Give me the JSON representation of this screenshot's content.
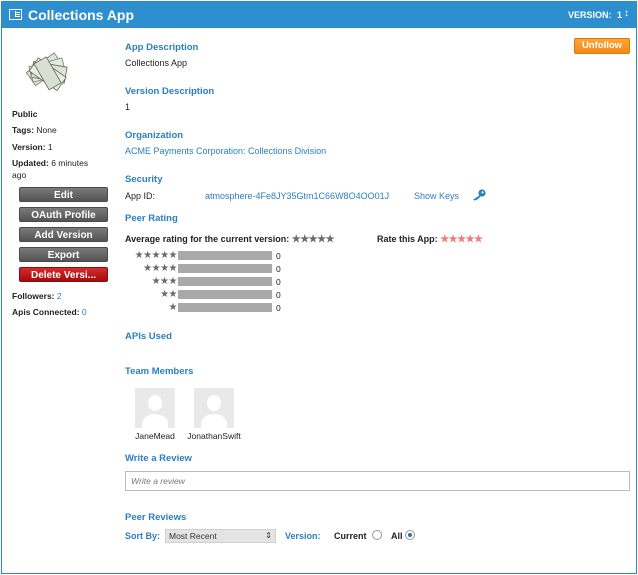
{
  "header": {
    "title": "Collections App",
    "version_label": "VERSION:",
    "version_value": "1",
    "version_caret": "↕"
  },
  "sidebar": {
    "visibility": "Public",
    "tags_label": "Tags:",
    "tags_value": "None",
    "version_label": "Version:",
    "version_value": "1",
    "updated_label": "Updated:",
    "updated_value": "6 minutes ago",
    "buttons": [
      "Edit",
      "OAuth Profile",
      "Add Version",
      "Export",
      "Delete Versi..."
    ],
    "followers_label": "Followers:",
    "followers_value": "2",
    "apis_label": "Apis Connected:",
    "apis_value": "0"
  },
  "main": {
    "unfollow_label": "Unfollow",
    "app_description_heading": "App Description",
    "app_description": "Collections App",
    "version_description_heading": "Version Description",
    "version_description": "1",
    "organization_heading": "Organization",
    "organization": "ACME Payments Corporation: Collections Division",
    "security_heading": "Security",
    "app_id_label": "App ID:",
    "app_id_value": "atmosphere-4Fe8JY35Gtm1C66W8O4OO01J",
    "show_keys_label": "Show Keys",
    "peer_rating_heading": "Peer Rating",
    "avg_rating_label": "Average rating for the current version:",
    "avg_rating_stars": "★★★★★",
    "rate_label": "Rate this App:",
    "rate_stars": "★★★★★",
    "rating_rows": [
      {
        "stars": "★★★★★",
        "count": "0"
      },
      {
        "stars": "★★★★",
        "count": "0"
      },
      {
        "stars": "★★★",
        "count": "0"
      },
      {
        "stars": "★★",
        "count": "0"
      },
      {
        "stars": "★",
        "count": "0"
      }
    ],
    "apis_used_heading": "APIs Used",
    "team_heading": "Team Members",
    "team": [
      "JaneMead",
      "JonathanSwift"
    ],
    "write_review_heading": "Write a Review",
    "review_placeholder": "Write a review",
    "peer_reviews_heading": "Peer Reviews",
    "sort_by_label": "Sort By:",
    "sort_by_value": "Most Recent",
    "version_filter_label": "Version:",
    "current_label": "Current",
    "all_label": "All"
  },
  "icons": {
    "app": "app-window-icon",
    "key": "key-icon",
    "money": "money-stack-icon",
    "avatar": "user-silhouette-icon"
  },
  "colors": {
    "header": "#2e8fcf",
    "link": "#2a7fc1",
    "unfollow": "#f3891a",
    "delete": "#c01a1a",
    "rate_stars": "#f27a7a"
  }
}
